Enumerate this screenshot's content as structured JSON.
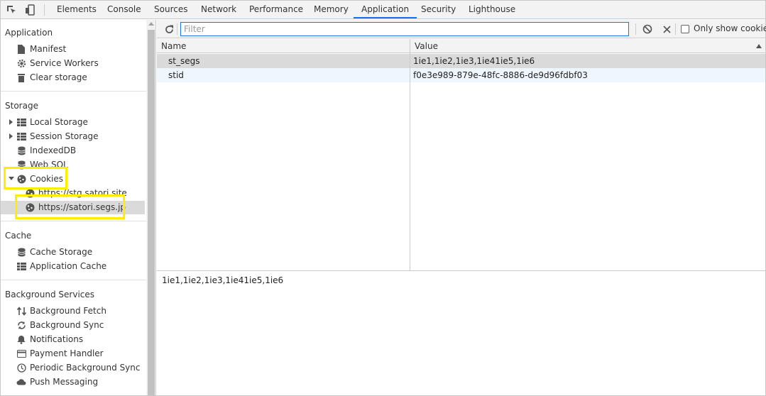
{
  "toolbar": {
    "inspect_icon": "inspect-element-icon",
    "device_icon": "device-toolbar-icon",
    "tabs": [
      {
        "label": "Elements"
      },
      {
        "label": "Console"
      },
      {
        "label": "Sources"
      },
      {
        "label": "Network"
      },
      {
        "label": "Performance"
      },
      {
        "label": "Memory"
      },
      {
        "label": "Application",
        "active": true
      },
      {
        "label": "Security"
      },
      {
        "label": "Lighthouse"
      }
    ]
  },
  "sidebar": {
    "application": {
      "heading": "Application",
      "items": [
        {
          "label": "Manifest",
          "icon": "document-icon"
        },
        {
          "label": "Service Workers",
          "icon": "gear-icon"
        },
        {
          "label": "Clear storage",
          "icon": "trash-icon"
        }
      ]
    },
    "storage": {
      "heading": "Storage",
      "items": [
        {
          "label": "Local Storage",
          "icon": "grid-icon"
        },
        {
          "label": "Session Storage",
          "icon": "grid-icon"
        },
        {
          "label": "IndexedDB",
          "icon": "database-icon"
        },
        {
          "label": "Web SQL",
          "icon": "database-icon"
        },
        {
          "label": "Cookies",
          "icon": "cookie-icon"
        },
        {
          "label": "https://stg.satori.site",
          "icon": "cookie-icon"
        },
        {
          "label": "https://satori.segs.jp",
          "icon": "cookie-icon",
          "selected": true
        }
      ]
    },
    "cache": {
      "heading": "Cache",
      "items": [
        {
          "label": "Cache Storage",
          "icon": "database-icon"
        },
        {
          "label": "Application Cache",
          "icon": "grid-icon"
        }
      ]
    },
    "background": {
      "heading": "Background Services",
      "items": [
        {
          "label": "Background Fetch",
          "icon": "fetch-arrows-icon"
        },
        {
          "label": "Background Sync",
          "icon": "sync-icon"
        },
        {
          "label": "Notifications",
          "icon": "bell-icon"
        },
        {
          "label": "Payment Handler",
          "icon": "card-icon"
        },
        {
          "label": "Periodic Background Sync",
          "icon": "clock-icon"
        },
        {
          "label": "Push Messaging",
          "icon": "cloud-icon"
        }
      ]
    }
  },
  "filter": {
    "placeholder": "Filter",
    "value": "",
    "only_show_cookies_label": "Only show cookies"
  },
  "table": {
    "columns": [
      "Name",
      "Value"
    ],
    "rows": [
      {
        "name": "st_segs",
        "value": "1ie1,1ie2,1ie3,1ie41ie5,1ie6",
        "selected": true
      },
      {
        "name": "stid",
        "value": "f0e3e989-879e-48fc-8886-de9d96fdbf03"
      }
    ]
  },
  "preview": {
    "text": "1ie1,1ie2,1ie3,1ie41ie5,1ie6"
  },
  "colors": {
    "highlight": "#ffee00",
    "accent": "#1a73e8",
    "selected_row": "#dadada",
    "alt_row": "#f0f6fe"
  }
}
